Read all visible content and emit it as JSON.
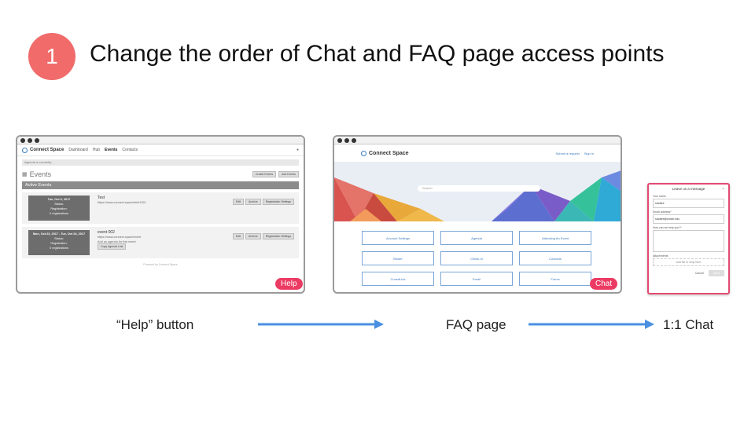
{
  "step": "1",
  "title": "Change the order of Chat and FAQ page access points",
  "colors": {
    "badge": "#f16b6b",
    "pill": "#ec3b63",
    "arrow": "#4a90e2",
    "chat_border": "#e34a72"
  },
  "events_screen": {
    "logo": "Connect Space",
    "nav": [
      "Dashboard",
      "Hub",
      "Events",
      "Contacts"
    ],
    "search_hint": "Agenda is currently...",
    "heading": "Events",
    "header_buttons": [
      "Create Events",
      "Add Events"
    ],
    "section": "Active Events",
    "events": [
      {
        "date": "Tue, Oct 3, 2017",
        "status": "Status:",
        "registration": "Registration:",
        "registrants": "0 registrations",
        "name": "Test",
        "url": "https://www.connect.space/test/1109",
        "actions": [
          "Edit",
          "Archive",
          "Registration Settings"
        ]
      },
      {
        "date": "Mon, Oct 23, 2017 - Tue, Oct 24, 2017",
        "status": "Status:",
        "registration": "Registration:",
        "registrants": "0 registrations",
        "name": "event 002",
        "url": "https://www.connect.space/event",
        "note": "Add an agenda for this event",
        "actions": [
          "Edit",
          "Archive",
          "Registration Settings"
        ],
        "extra_button": "Copy Agenda Link"
      }
    ],
    "footer": "Powered by Connect Space",
    "help_button": "Help"
  },
  "faq_screen": {
    "logo": "Connect Space",
    "nav_links": [
      "Submit a request",
      "Sign in"
    ],
    "search_placeholder": "Search",
    "topics": [
      "Account Settings",
      "Agenda",
      "Attending An Event",
      "Binder",
      "Check-in",
      "Contacts",
      "CrowdLink",
      "Email",
      "Forms"
    ],
    "chat_button": "Chat"
  },
  "chat_screen": {
    "title": "Leave us a message",
    "name_label": "Your name",
    "name_value": "student",
    "email_label": "Email address*",
    "email_value": "student@umich.edu",
    "message_label": "How can we help you?*",
    "attachments_label": "Attachments",
    "attach_hint": "Add file or drop here",
    "cancel": "Cancel",
    "send": "Send"
  },
  "captions": {
    "help": "“Help” button",
    "faq": "FAQ page",
    "chat": "1:1 Chat"
  }
}
